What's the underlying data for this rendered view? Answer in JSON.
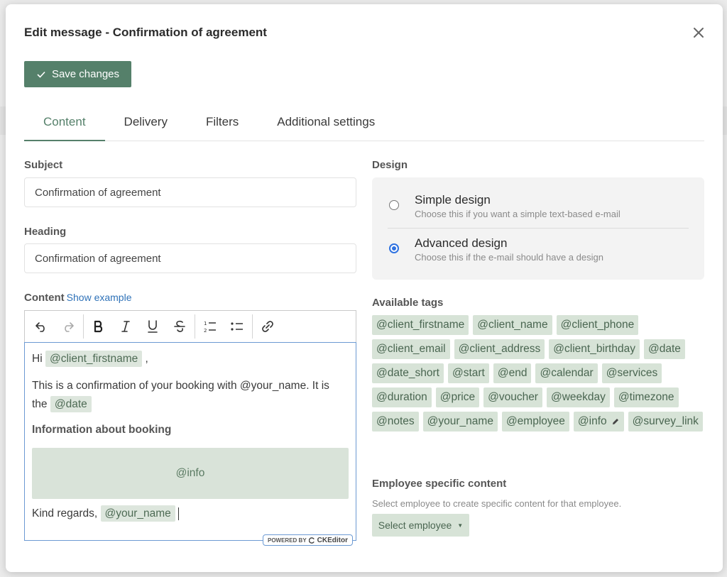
{
  "modal": {
    "title": "Edit message - Confirmation of agreement",
    "save_label": "Save changes"
  },
  "tabs": [
    {
      "label": "Content",
      "active": true
    },
    {
      "label": "Delivery",
      "active": false
    },
    {
      "label": "Filters",
      "active": false
    },
    {
      "label": "Additional settings",
      "active": false
    }
  ],
  "subject": {
    "label": "Subject",
    "value": "Confirmation of agreement"
  },
  "heading": {
    "label": "Heading",
    "value": "Confirmation of agreement"
  },
  "content": {
    "label": "Content",
    "show_example": "Show example",
    "toolbar": [
      "undo-icon",
      "redo-icon",
      "bold-icon",
      "italic-icon",
      "underline-icon",
      "strikethrough-icon",
      "numbered-list-icon",
      "bulleted-list-icon",
      "link-icon"
    ],
    "editor": {
      "greeting": "Hi",
      "greeting_tag": "@client_firstname",
      "greeting_end": ",",
      "body_line1": "This is a confirmation of your booking with @your_name. It is",
      "body_line2": "the",
      "body_tag": "@date",
      "info_heading": "Information about booking",
      "info_block": "@info",
      "closing": "Kind regards,",
      "closing_tag": "@your_name"
    },
    "badge_powered": "POWERED BY",
    "badge_brand": "CKEditor"
  },
  "design": {
    "label": "Design",
    "options": [
      {
        "title": "Simple design",
        "desc": "Choose this if you want a simple text-based e-mail",
        "selected": false
      },
      {
        "title": "Advanced design",
        "desc": "Choose this if the e-mail should have a design",
        "selected": true
      }
    ]
  },
  "tags": {
    "label": "Available tags",
    "items": [
      "@client_firstname",
      "@client_name",
      "@client_phone",
      "@client_email",
      "@client_address",
      "@client_birthday",
      "@date",
      "@date_short",
      "@start",
      "@end",
      "@calendar",
      "@services",
      "@duration",
      "@price",
      "@voucher",
      "@weekday",
      "@timezone",
      "@notes",
      "@your_name",
      "@employee",
      "@info",
      "@survey_link"
    ]
  },
  "employee": {
    "label": "Employee specific content",
    "desc": "Select employee to create specific content for that employee.",
    "select_label": "Select employee"
  },
  "colors": {
    "accent": "#55806a",
    "tag_bg": "#d7e3d7",
    "link": "#2f72b8",
    "radio_selected": "#2f72e0"
  }
}
